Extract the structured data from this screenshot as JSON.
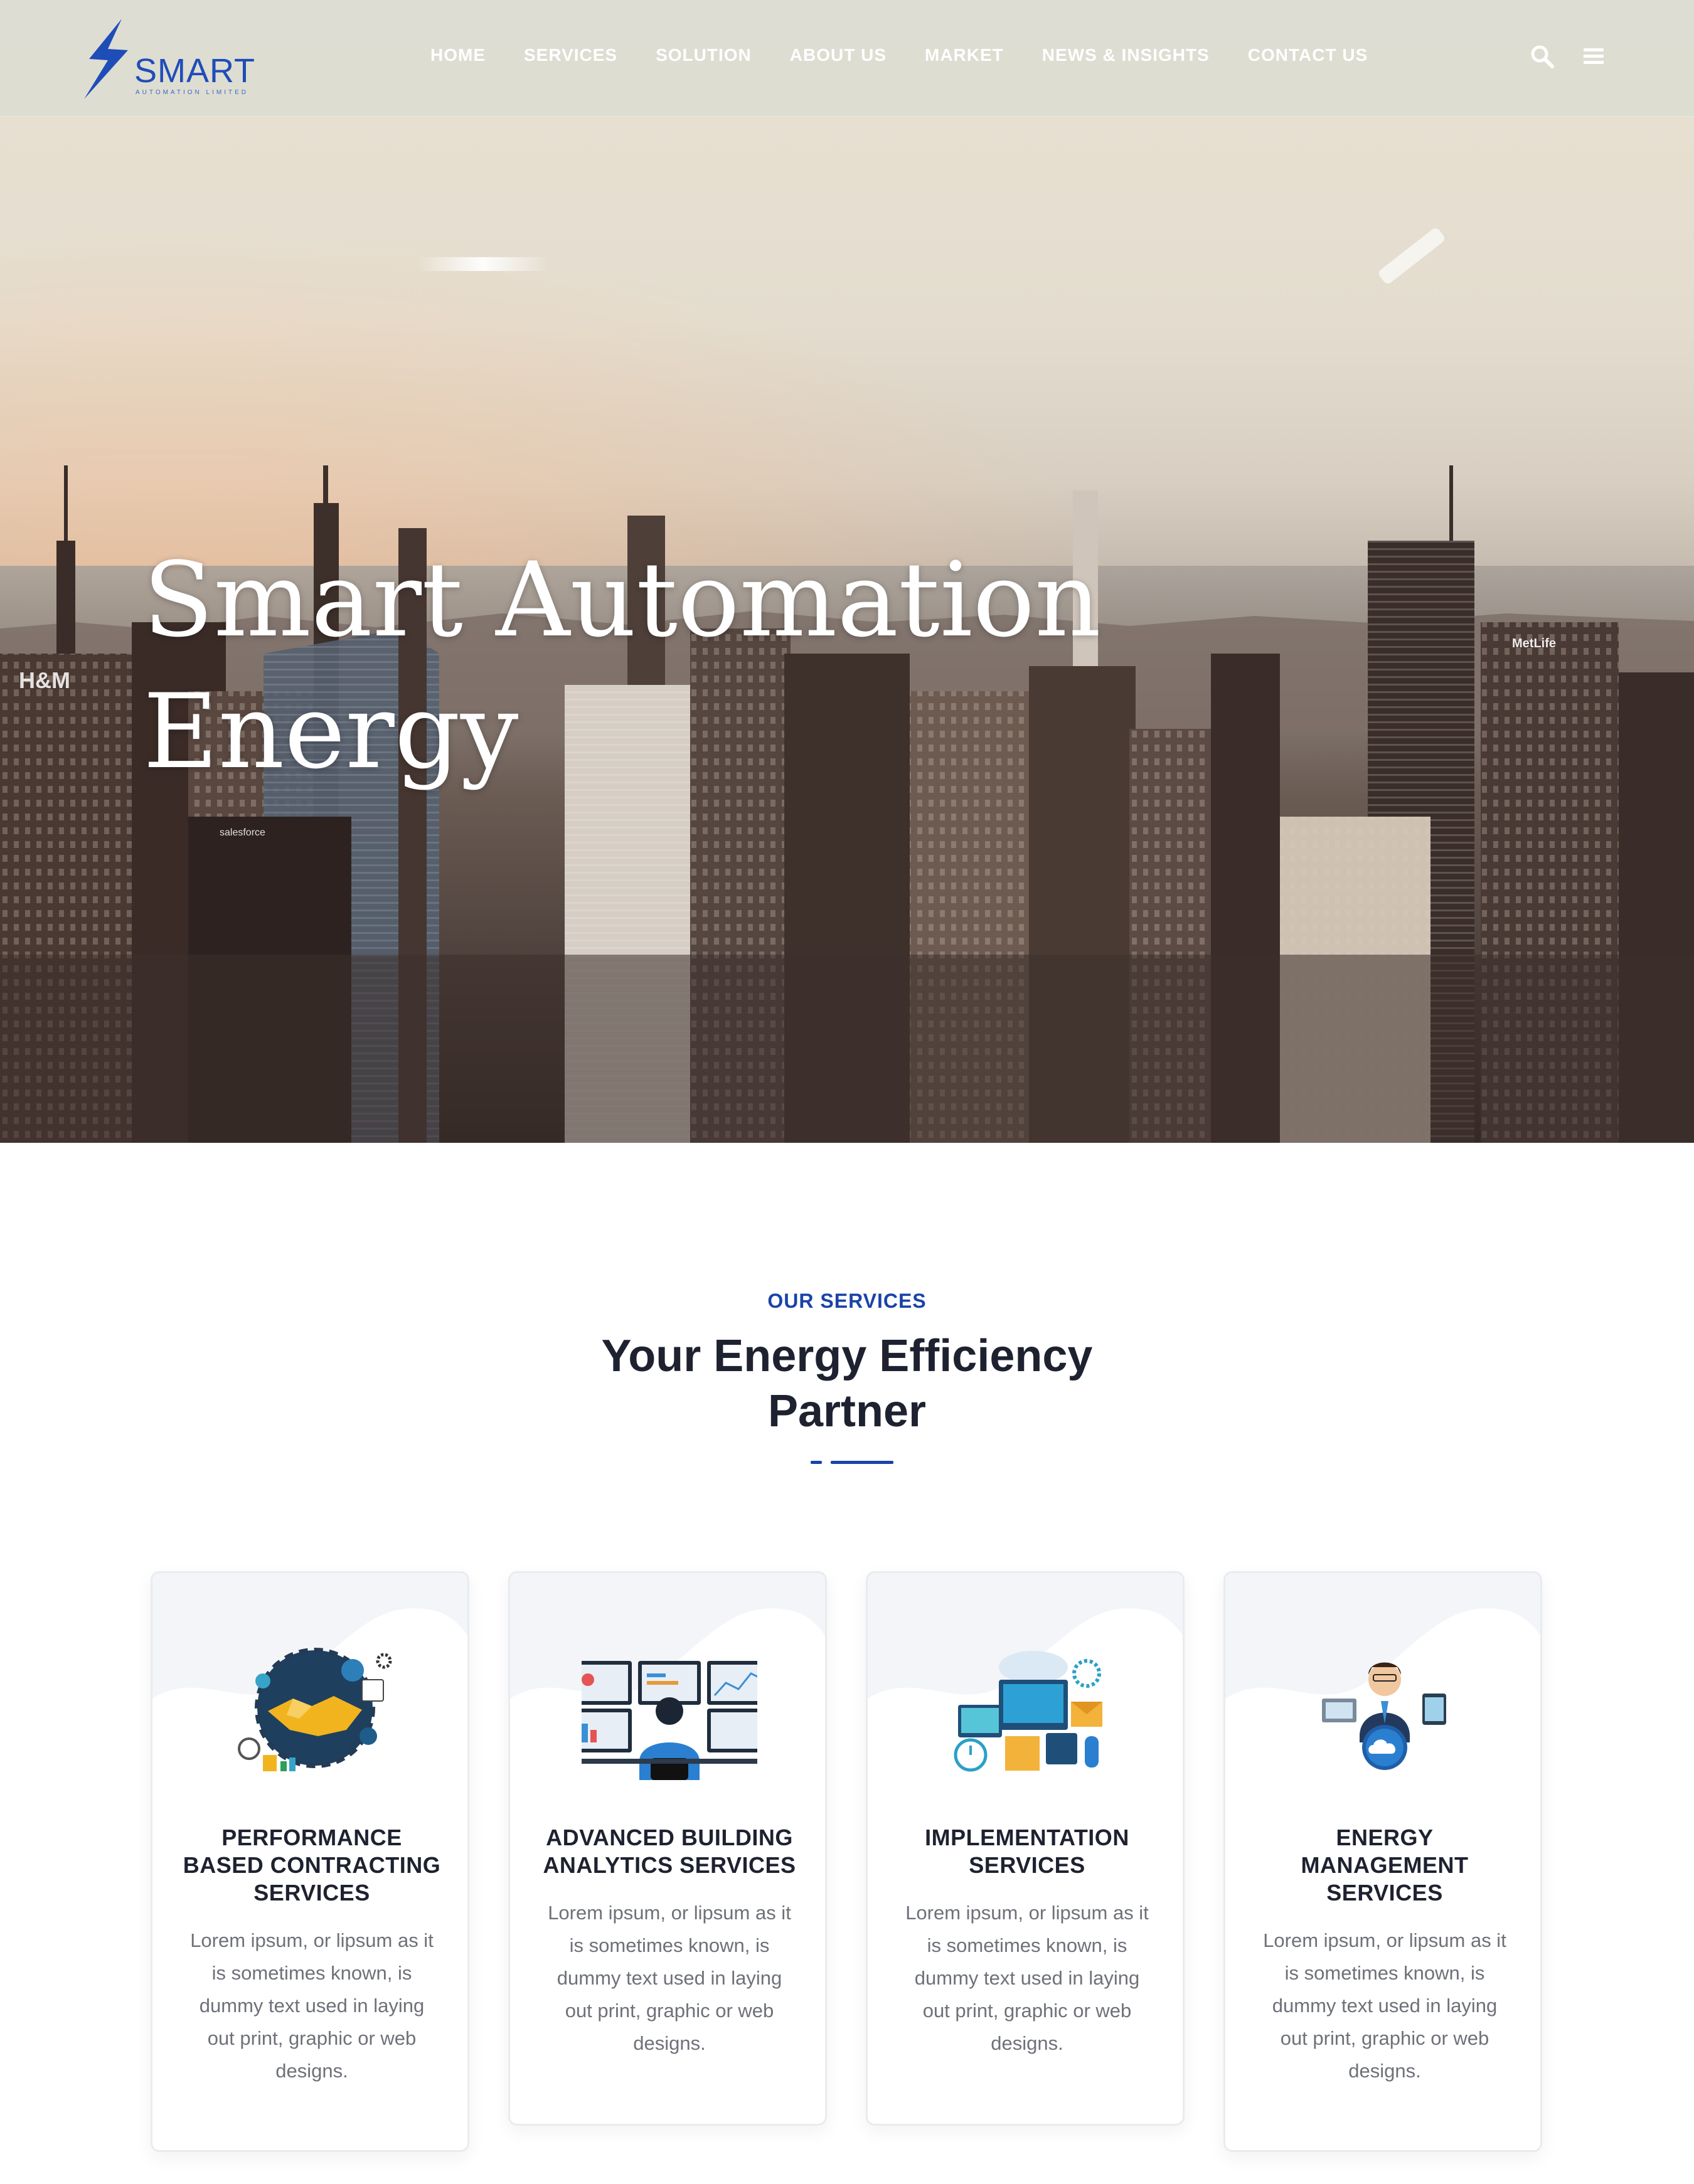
{
  "brand": {
    "name": "SMART",
    "tagline": "AUTOMATION LIMITED",
    "accent_color": "#1a43a8"
  },
  "nav": {
    "items": [
      {
        "label": "HOME"
      },
      {
        "label": "SERVICES"
      },
      {
        "label": "SOLUTION"
      },
      {
        "label": "ABOUT US"
      },
      {
        "label": "MARKET"
      },
      {
        "label": "NEWS & INSIGHTS"
      },
      {
        "label": "CONTACT US"
      }
    ],
    "icons": [
      "search-icon",
      "menu-icon"
    ]
  },
  "hero": {
    "title_line1": "Smart Automation",
    "title_line2": "Energy",
    "billboards": [
      "H&M",
      "salesforce",
      "MetLife"
    ]
  },
  "services": {
    "kicker": "OUR SERVICES",
    "title_line1": "Your Energy Efficiency",
    "title_line2": "Partner",
    "cards": [
      {
        "title_lines": [
          "PERFORMANCE",
          "BASED CONTRACTING",
          "SERVICES"
        ],
        "text_lines": [
          "Lorem ipsum, or lipsum as it",
          "is sometimes known, is",
          "dummy text used in laying",
          "out print, graphic or web",
          "designs."
        ],
        "icon": "handshake-gears-icon"
      },
      {
        "title_lines": [
          "ADVANCED BUILDING",
          "ANALYTICS SERVICES"
        ],
        "text_lines": [
          "Lorem ipsum, or lipsum as it",
          "is sometimes known, is",
          "dummy text used in laying",
          "out print, graphic or web",
          "designs."
        ],
        "icon": "analytics-monitors-icon"
      },
      {
        "title_lines": [
          "IMPLEMENTATION",
          "SERVICES"
        ],
        "text_lines": [
          "Lorem ipsum, or lipsum as it",
          "is sometimes known, is",
          "dummy text used in laying",
          "out print, graphic or web",
          "designs."
        ],
        "icon": "devices-cloud-icon"
      },
      {
        "title_lines": [
          "ENERGY",
          "MANAGEMENT",
          "SERVICES"
        ],
        "text_lines": [
          "Lorem ipsum, or lipsum as it",
          "is sometimes known, is",
          "dummy text used in laying",
          "out print, graphic or web",
          "designs."
        ],
        "icon": "businessman-cloud-icon"
      }
    ]
  }
}
